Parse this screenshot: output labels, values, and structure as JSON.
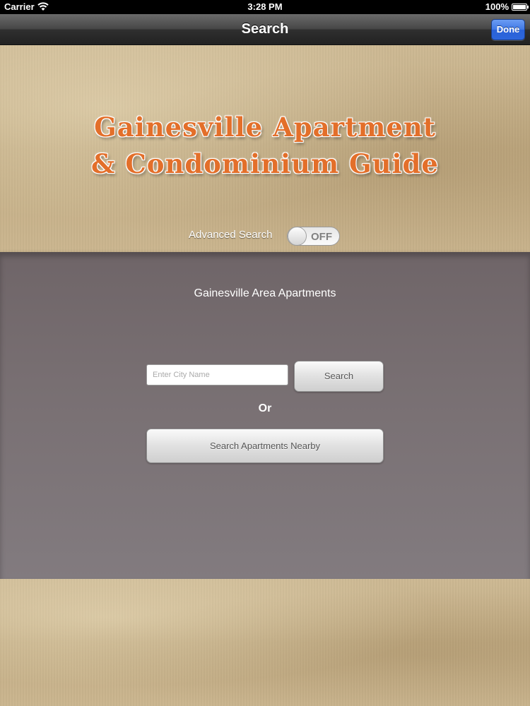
{
  "status_bar": {
    "carrier": "Carrier",
    "time": "3:28 PM",
    "battery": "100%"
  },
  "nav_bar": {
    "title": "Search",
    "done_label": "Done"
  },
  "header": {
    "title_line1": "Gainesville Apartment",
    "title_line2": "& Condominium Guide"
  },
  "advanced_search": {
    "label": "Advanced Search",
    "toggle_state": "OFF"
  },
  "panel": {
    "title": "Gainesville Area Apartments",
    "city_placeholder": "Enter City Name",
    "search_label": "Search",
    "or_label": "Or",
    "nearby_label": "Search Apartments Nearby"
  },
  "colors": {
    "title_orange": "#e36f2a",
    "done_blue": "#3f78e6",
    "panel_gray": "#786f72"
  }
}
